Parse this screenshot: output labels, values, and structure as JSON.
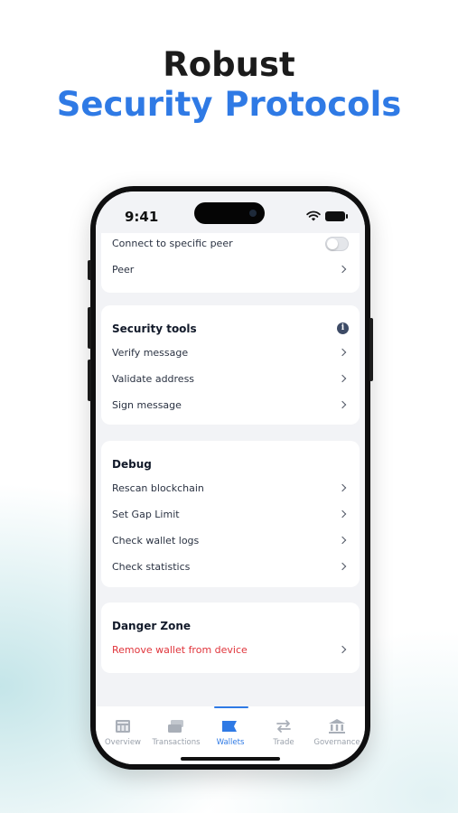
{
  "promo": {
    "line1": "Robust",
    "line2": "Security Protocols"
  },
  "status_bar": {
    "time": "9:41"
  },
  "peer_section": {
    "connect_label": "Connect to specific peer",
    "connect_enabled": false,
    "peer_label": "Peer"
  },
  "security_tools": {
    "title": "Security tools",
    "items": [
      {
        "label": "Verify message"
      },
      {
        "label": "Validate address"
      },
      {
        "label": "Sign message"
      }
    ]
  },
  "debug": {
    "title": "Debug",
    "items": [
      {
        "label": "Rescan blockchain"
      },
      {
        "label": "Set Gap Limit"
      },
      {
        "label": "Check wallet logs"
      },
      {
        "label": "Check statistics"
      }
    ]
  },
  "danger_zone": {
    "title": "Danger Zone",
    "remove_label": "Remove wallet from device"
  },
  "tabs": [
    {
      "label": "Overview",
      "icon": "overview-icon"
    },
    {
      "label": "Transactions",
      "icon": "transactions-icon"
    },
    {
      "label": "Wallets",
      "icon": "wallet-icon",
      "active": true
    },
    {
      "label": "Trade",
      "icon": "trade-icon"
    },
    {
      "label": "Governance",
      "icon": "governance-icon"
    }
  ],
  "colors": {
    "accent": "#2f7ae5",
    "danger": "#e0343b",
    "headline": "#1b1b1b"
  }
}
